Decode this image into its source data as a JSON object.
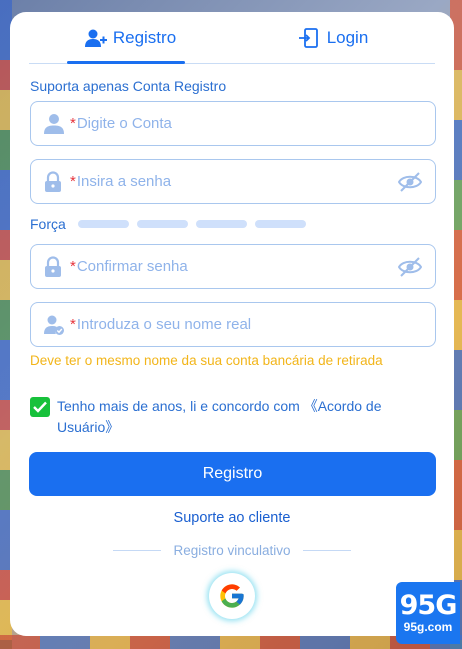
{
  "tabs": [
    {
      "label": "Registro",
      "icon": "add-user-icon",
      "active": true
    },
    {
      "label": "Login",
      "icon": "login-door-icon",
      "active": false
    }
  ],
  "hint_top": "Suporta apenas Conta Registro",
  "fields": {
    "account": {
      "required_mark": "*",
      "placeholder": "Digite o Conta",
      "icon": "user-icon"
    },
    "password": {
      "required_mark": "*",
      "placeholder": "Insira a senha",
      "icon": "lock-icon"
    },
    "confirm": {
      "required_mark": "*",
      "placeholder": "Confirmar senha",
      "icon": "lock-icon"
    },
    "realname": {
      "required_mark": "*",
      "placeholder": "Introduza o seu nome real",
      "icon": "verified-user-icon"
    }
  },
  "strength_label": "Força",
  "realname_warning": "Deve ter o mesmo nome da sua conta bancária de retirada",
  "agreement": {
    "checked": true,
    "text": "Tenho mais de anos, li e concordo com 《Acordo de Usuário》"
  },
  "register_button": "Registro",
  "support_link": "Suporte ao cliente",
  "divider_text": "Registro vinculativo",
  "brand": {
    "big": "95G",
    "small": "95g.com"
  },
  "colors": {
    "accent": "#1a6ff0",
    "warning": "#f2b51a",
    "checkbox": "#17c13b",
    "required": "#e6343c"
  }
}
